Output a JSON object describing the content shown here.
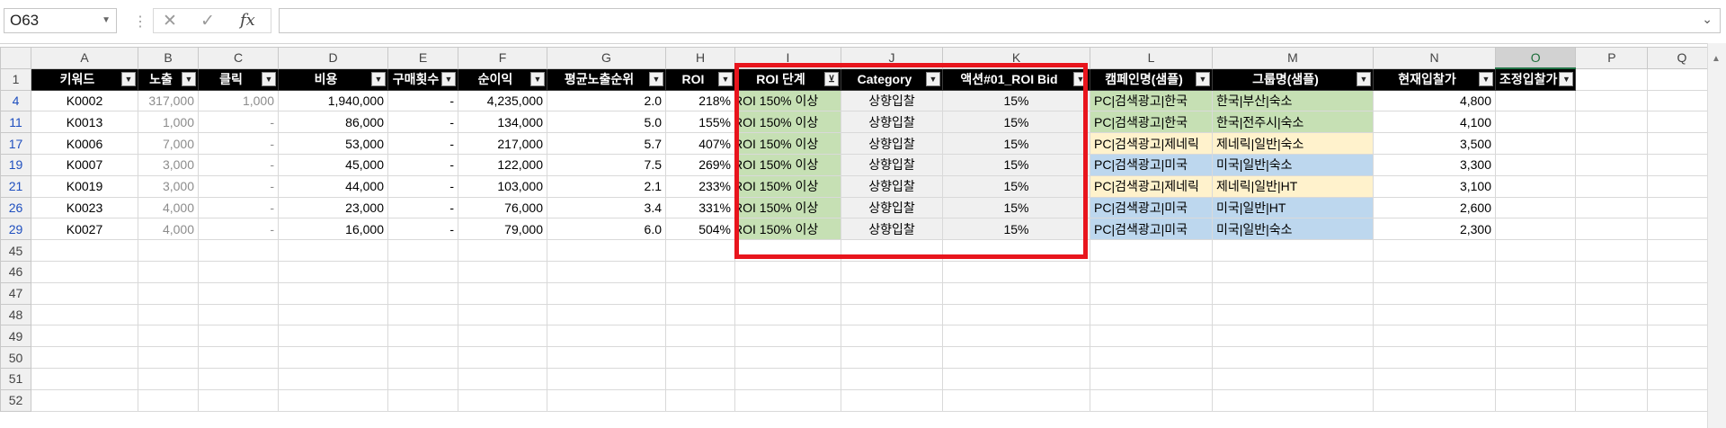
{
  "formula_bar": {
    "name_box": "O63",
    "separator": "⋮",
    "cancel_icon": "✕",
    "enter_icon": "✓",
    "fx_label": "fx",
    "formula_value": ""
  },
  "columns": [
    "A",
    "B",
    "C",
    "D",
    "E",
    "F",
    "G",
    "H",
    "I",
    "J",
    "K",
    "L",
    "M",
    "N",
    "O",
    "P",
    "Q"
  ],
  "selected_column": "O",
  "header_row": {
    "row_number": "1",
    "labels": [
      "키워드",
      "노출",
      "클릭",
      "비용",
      "구매횟수",
      "순이익",
      "평균노출순위",
      "ROI",
      "ROI 단계",
      "Category",
      "액션#01_ROI Bid",
      "캠페인명(샘플)",
      "그룹명(샘플)",
      "현재입찰가",
      "조정입찰가"
    ],
    "filter_active_index": 8
  },
  "rows": [
    {
      "row": "4",
      "cells": [
        "K0002",
        "317,000",
        "1,000",
        "1,940,000",
        "-",
        "4,235,000",
        "2.0",
        "218%",
        "ROI 150% 이상",
        "상향입찰",
        "15%",
        "PC|검색광고|한국",
        "한국|부산|숙소",
        "4,800",
        ""
      ],
      "l_color": "green",
      "m_color": "green"
    },
    {
      "row": "11",
      "cells": [
        "K0013",
        "1,000",
        "-",
        "86,000",
        "-",
        "134,000",
        "5.0",
        "155%",
        "ROI 150% 이상",
        "상향입찰",
        "15%",
        "PC|검색광고|한국",
        "한국|전주시|숙소",
        "4,100",
        ""
      ],
      "l_color": "green",
      "m_color": "green"
    },
    {
      "row": "17",
      "cells": [
        "K0006",
        "7,000",
        "-",
        "53,000",
        "-",
        "217,000",
        "5.7",
        "407%",
        "ROI 150% 이상",
        "상향입찰",
        "15%",
        "PC|검색광고|제네릭",
        "제네릭|일반|숙소",
        "3,500",
        ""
      ],
      "l_color": "yellow",
      "m_color": "yellow"
    },
    {
      "row": "19",
      "cells": [
        "K0007",
        "3,000",
        "-",
        "45,000",
        "-",
        "122,000",
        "7.5",
        "269%",
        "ROI 150% 이상",
        "상향입찰",
        "15%",
        "PC|검색광고|미국",
        "미국|일반|숙소",
        "3,300",
        ""
      ],
      "l_color": "blue",
      "m_color": "blue"
    },
    {
      "row": "21",
      "cells": [
        "K0019",
        "3,000",
        "-",
        "44,000",
        "-",
        "103,000",
        "2.1",
        "233%",
        "ROI 150% 이상",
        "상향입찰",
        "15%",
        "PC|검색광고|제네릭",
        "제네릭|일반|HT",
        "3,100",
        ""
      ],
      "l_color": "yellow",
      "m_color": "yellow"
    },
    {
      "row": "26",
      "cells": [
        "K0023",
        "4,000",
        "-",
        "23,000",
        "-",
        "76,000",
        "3.4",
        "331%",
        "ROI 150% 이상",
        "상향입찰",
        "15%",
        "PC|검색광고|미국",
        "미국|일반|HT",
        "2,600",
        ""
      ],
      "l_color": "blue",
      "m_color": "blue"
    },
    {
      "row": "29",
      "cells": [
        "K0027",
        "4,000",
        "-",
        "16,000",
        "-",
        "79,000",
        "6.0",
        "504%",
        "ROI 150% 이상",
        "상향입찰",
        "15%",
        "PC|검색광고|미국",
        "미국|일반|숙소",
        "2,300",
        ""
      ],
      "l_color": "blue",
      "m_color": "blue"
    }
  ],
  "empty_rows": [
    "45",
    "46",
    "47",
    "48",
    "49",
    "50",
    "51",
    "52"
  ],
  "highlight_color": "#e8151d"
}
